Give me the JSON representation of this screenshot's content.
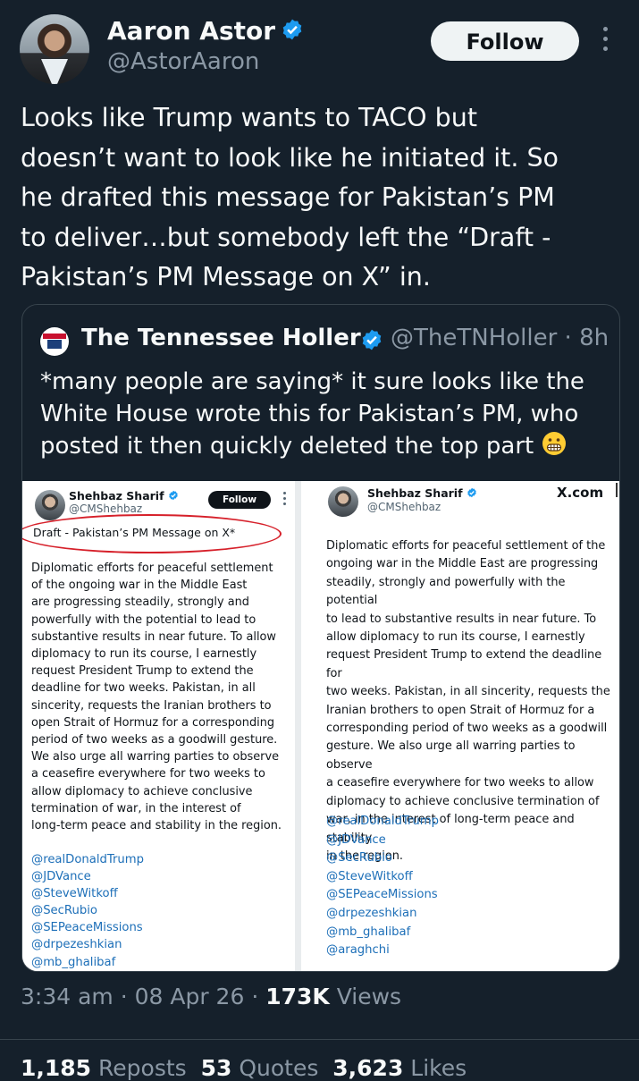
{
  "author": {
    "name": "Aaron Astor",
    "handle": "@AstorAaron",
    "follow_label": "Follow"
  },
  "tweet": {
    "text": "Looks like Trump wants to TACO but\ndoesn’t want to look like he initiated it. So\nhe drafted this message for Pakistan’s PM\nto deliver…but somebody left the “Draft -\nPakistan’s PM Message on X” in."
  },
  "quoted": {
    "name": "The Tennessee Holler",
    "handle_time": "@TheTNHoller · 8h",
    "text": "*many people are saying* it sure looks like the\nWhite House wrote this for Pakistan’s PM, who\nposted it then quickly deleted the top part"
  },
  "screenshot_left": {
    "name": "Shehbaz Sharif",
    "handle": "@CMShehbaz",
    "follow_label": "Follow",
    "draft_label": "Draft - Pakistan’s PM Message on X*",
    "body": "Diplomatic efforts for peaceful settlement\nof the ongoing war in the Middle East\nare progressing steadily, strongly and\npowerfully with the potential to lead to\nsubstantive results in near future. To allow\ndiplomacy to run its course, I earnestly\nrequest President Trump to extend the\ndeadline for two weeks. Pakistan, in all\nsincerity, requests the Iranian brothers to\nopen Strait of Hormuz for a corresponding\nperiod of two weeks as a goodwill gesture.\nWe also urge all warring parties to observe\na ceasefire everywhere for two weeks to\nallow diplomacy to achieve conclusive\ntermination of war, in the interest of\nlong-term peace and stability in the region.",
    "mentions": [
      "@realDonaldTrump",
      "@JDVance",
      "@SteveWitkoff",
      "@SecRubio",
      "@SEPeaceMissions",
      "@drpezeshkian",
      "@mb_ghalibaf"
    ]
  },
  "screenshot_right": {
    "name": "Shehbaz Sharif",
    "handle": "@CMShehbaz",
    "source": "X.com",
    "body": "Diplomatic efforts for peaceful settlement of the\nongoing war in the Middle East are progressing\nsteadily, strongly and powerfully with the potential\nto lead to substantive results in near future. To\nallow diplomacy to run its course, I earnestly\nrequest President Trump to extend the deadline for\ntwo weeks. Pakistan, in all sincerity, requests the\nIranian brothers to open Strait of Hormuz for a\ncorresponding period of two weeks as a goodwill\ngesture. We also urge all warring parties to observe\na ceasefire everywhere for two weeks to allow\ndiplomacy to achieve conclusive termination of\nwar, in the interest of long-term peace and stability\nin the region.",
    "mentions": [
      "@realDonaldTrump",
      "@JDVance",
      "@SecRubio",
      "@SteveWitkoff",
      "@SEPeaceMissions",
      "@drpezeshkian",
      "@mb_ghalibaf",
      "@araghchi"
    ]
  },
  "meta": {
    "time_date": "3:34 am · 08 Apr 26 · ",
    "views_count": "173K",
    "views_label": " Views"
  },
  "stats": {
    "reposts_count": "1,185",
    "reposts_label": " Reposts",
    "quotes_count": "53",
    "quotes_label": " Quotes",
    "likes_count": "3,623",
    "likes_label": " Likes"
  },
  "colors": {
    "background": "#15202b",
    "verified_blue": "#1d9bf0",
    "secondary_text": "#8b98a5",
    "link_blue": "#1d6fb8",
    "draft_circle_red": "#d6202a"
  },
  "icons": [
    "verified-badge-icon",
    "more-options-icon",
    "grimacing-face-icon",
    "tennessee-holler-logo"
  ]
}
